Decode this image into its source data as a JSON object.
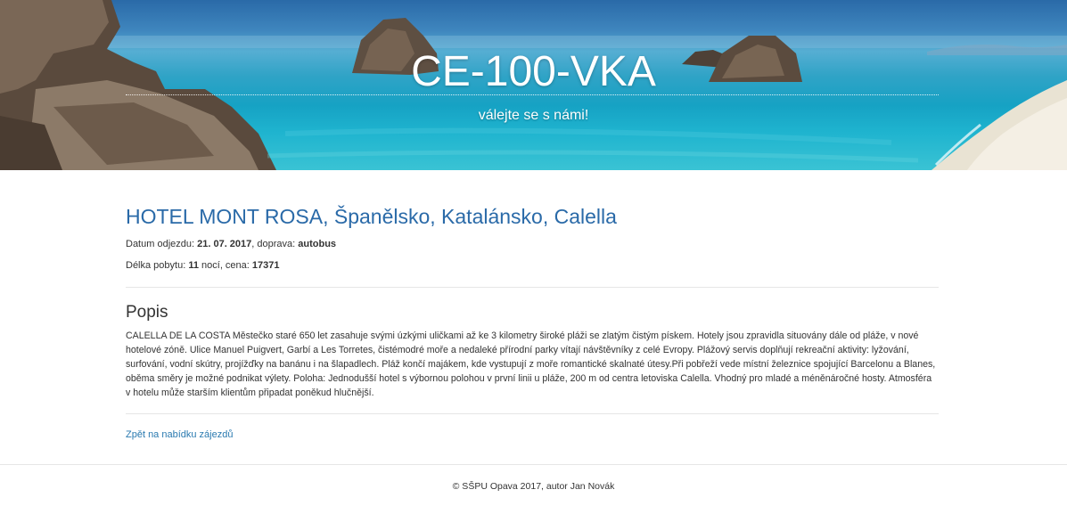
{
  "header": {
    "brand": "CE-100-VKA",
    "tagline": "válejte se s námi!"
  },
  "hotel": {
    "title": "HOTEL MONT ROSA, Španělsko, Katalánsko, Calella",
    "departure_label": "Datum odjezdu: ",
    "departure_value": "21. 07. 2017",
    "transport_label": ", doprava: ",
    "transport_value": "autobus",
    "stay_label": "Délka pobytu: ",
    "stay_value": "11",
    "nights_label": " nocí, cena: ",
    "price_value": "17371"
  },
  "description": {
    "heading": "Popis",
    "text": "CALELLA DE LA COSTA Městečko staré 650 let zasahuje svými úzkými uličkami až ke 3 kilometry široké pláži se zlatým čistým pískem. Hotely jsou zpravidla situovány dále od pláže, v nové hotelové zóně. Ulice Manuel Puigvert, Garbí a Les Torretes, čistémodré moře a nedaleké přírodní parky vítají návštěvníky z celé Evropy. Plážový servis doplňují rekreační aktivity: lyžování, surfování, vodní skútry, projížďky na banánu i na šlapadlech. Pláž končí majákem, kde vystupují z moře romantické skalnaté útesy.Při pobřeží vede místní železnice spojující Barcelonu a Blanes, oběma směry je možné podnikat výlety. Poloha: Jednodušší hotel s výbornou polohou v první linii u pláže, 200 m od centra letoviska Calella. Vhodný pro mladé a méněnáročné hosty. Atmosféra v hotelu může starším klientům připadat poněkud hlučnější."
  },
  "back_link": "Zpět na nabídku zájezdů",
  "footer": "© SŠPU Opava 2017, autor Jan Novák"
}
